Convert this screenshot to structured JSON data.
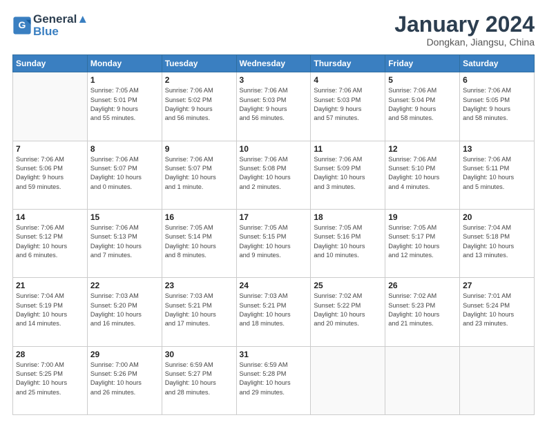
{
  "header": {
    "logo_line1": "General",
    "logo_line2": "Blue",
    "month_title": "January 2024",
    "location": "Dongkan, Jiangsu, China"
  },
  "weekdays": [
    "Sunday",
    "Monday",
    "Tuesday",
    "Wednesday",
    "Thursday",
    "Friday",
    "Saturday"
  ],
  "weeks": [
    [
      {
        "day": "",
        "info": ""
      },
      {
        "day": "1",
        "info": "Sunrise: 7:05 AM\nSunset: 5:01 PM\nDaylight: 9 hours\nand 55 minutes."
      },
      {
        "day": "2",
        "info": "Sunrise: 7:06 AM\nSunset: 5:02 PM\nDaylight: 9 hours\nand 56 minutes."
      },
      {
        "day": "3",
        "info": "Sunrise: 7:06 AM\nSunset: 5:03 PM\nDaylight: 9 hours\nand 56 minutes."
      },
      {
        "day": "4",
        "info": "Sunrise: 7:06 AM\nSunset: 5:03 PM\nDaylight: 9 hours\nand 57 minutes."
      },
      {
        "day": "5",
        "info": "Sunrise: 7:06 AM\nSunset: 5:04 PM\nDaylight: 9 hours\nand 58 minutes."
      },
      {
        "day": "6",
        "info": "Sunrise: 7:06 AM\nSunset: 5:05 PM\nDaylight: 9 hours\nand 58 minutes."
      }
    ],
    [
      {
        "day": "7",
        "info": "Sunrise: 7:06 AM\nSunset: 5:06 PM\nDaylight: 9 hours\nand 59 minutes."
      },
      {
        "day": "8",
        "info": "Sunrise: 7:06 AM\nSunset: 5:07 PM\nDaylight: 10 hours\nand 0 minutes."
      },
      {
        "day": "9",
        "info": "Sunrise: 7:06 AM\nSunset: 5:07 PM\nDaylight: 10 hours\nand 1 minute."
      },
      {
        "day": "10",
        "info": "Sunrise: 7:06 AM\nSunset: 5:08 PM\nDaylight: 10 hours\nand 2 minutes."
      },
      {
        "day": "11",
        "info": "Sunrise: 7:06 AM\nSunset: 5:09 PM\nDaylight: 10 hours\nand 3 minutes."
      },
      {
        "day": "12",
        "info": "Sunrise: 7:06 AM\nSunset: 5:10 PM\nDaylight: 10 hours\nand 4 minutes."
      },
      {
        "day": "13",
        "info": "Sunrise: 7:06 AM\nSunset: 5:11 PM\nDaylight: 10 hours\nand 5 minutes."
      }
    ],
    [
      {
        "day": "14",
        "info": "Sunrise: 7:06 AM\nSunset: 5:12 PM\nDaylight: 10 hours\nand 6 minutes."
      },
      {
        "day": "15",
        "info": "Sunrise: 7:06 AM\nSunset: 5:13 PM\nDaylight: 10 hours\nand 7 minutes."
      },
      {
        "day": "16",
        "info": "Sunrise: 7:05 AM\nSunset: 5:14 PM\nDaylight: 10 hours\nand 8 minutes."
      },
      {
        "day": "17",
        "info": "Sunrise: 7:05 AM\nSunset: 5:15 PM\nDaylight: 10 hours\nand 9 minutes."
      },
      {
        "day": "18",
        "info": "Sunrise: 7:05 AM\nSunset: 5:16 PM\nDaylight: 10 hours\nand 10 minutes."
      },
      {
        "day": "19",
        "info": "Sunrise: 7:05 AM\nSunset: 5:17 PM\nDaylight: 10 hours\nand 12 minutes."
      },
      {
        "day": "20",
        "info": "Sunrise: 7:04 AM\nSunset: 5:18 PM\nDaylight: 10 hours\nand 13 minutes."
      }
    ],
    [
      {
        "day": "21",
        "info": "Sunrise: 7:04 AM\nSunset: 5:19 PM\nDaylight: 10 hours\nand 14 minutes."
      },
      {
        "day": "22",
        "info": "Sunrise: 7:03 AM\nSunset: 5:20 PM\nDaylight: 10 hours\nand 16 minutes."
      },
      {
        "day": "23",
        "info": "Sunrise: 7:03 AM\nSunset: 5:21 PM\nDaylight: 10 hours\nand 17 minutes."
      },
      {
        "day": "24",
        "info": "Sunrise: 7:03 AM\nSunset: 5:21 PM\nDaylight: 10 hours\nand 18 minutes."
      },
      {
        "day": "25",
        "info": "Sunrise: 7:02 AM\nSunset: 5:22 PM\nDaylight: 10 hours\nand 20 minutes."
      },
      {
        "day": "26",
        "info": "Sunrise: 7:02 AM\nSunset: 5:23 PM\nDaylight: 10 hours\nand 21 minutes."
      },
      {
        "day": "27",
        "info": "Sunrise: 7:01 AM\nSunset: 5:24 PM\nDaylight: 10 hours\nand 23 minutes."
      }
    ],
    [
      {
        "day": "28",
        "info": "Sunrise: 7:00 AM\nSunset: 5:25 PM\nDaylight: 10 hours\nand 25 minutes."
      },
      {
        "day": "29",
        "info": "Sunrise: 7:00 AM\nSunset: 5:26 PM\nDaylight: 10 hours\nand 26 minutes."
      },
      {
        "day": "30",
        "info": "Sunrise: 6:59 AM\nSunset: 5:27 PM\nDaylight: 10 hours\nand 28 minutes."
      },
      {
        "day": "31",
        "info": "Sunrise: 6:59 AM\nSunset: 5:28 PM\nDaylight: 10 hours\nand 29 minutes."
      },
      {
        "day": "",
        "info": ""
      },
      {
        "day": "",
        "info": ""
      },
      {
        "day": "",
        "info": ""
      }
    ]
  ]
}
